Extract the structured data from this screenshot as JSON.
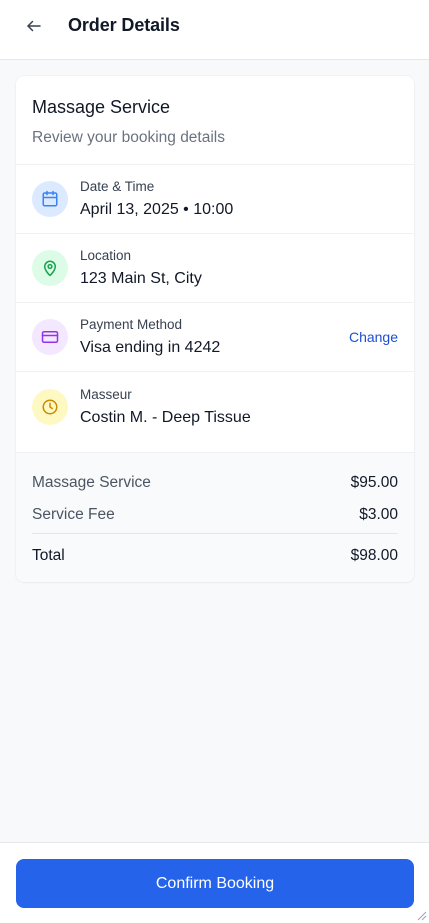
{
  "header": {
    "title": "Order Details",
    "back_icon": "arrow-left-icon"
  },
  "service": {
    "title": "Massage Service",
    "subtitle": "Review your booking details"
  },
  "details": [
    {
      "label": "Date & Time",
      "value": "April 13, 2025 • 10:00",
      "icon": "calendar-icon",
      "icon_color": "#3b82f6",
      "icon_bg": "#dbeafe"
    },
    {
      "label": "Location",
      "value": "123 Main St, City",
      "icon": "map-pin-icon",
      "icon_color": "#16a34a",
      "icon_bg": "#dcfce7"
    },
    {
      "label": "Payment Method",
      "value": "Visa ending in 4242",
      "icon": "credit-card-icon",
      "icon_color": "#9333ea",
      "icon_bg": "#f3e8ff",
      "action": "Change"
    },
    {
      "label": "Masseur",
      "value": "Costin M. - Deep Tissue",
      "icon": "clock-icon",
      "icon_color": "#ca8a04",
      "icon_bg": "#fef9c3"
    }
  ],
  "summary": {
    "lines": [
      {
        "label": "Massage Service",
        "amount": "$95.00"
      },
      {
        "label": "Service Fee",
        "amount": "$3.00"
      }
    ],
    "total_label": "Total",
    "total_amount": "$98.00"
  },
  "footer": {
    "confirm_label": "Confirm Booking"
  },
  "colors": {
    "accent": "#2563eb",
    "link": "#1d4ed8"
  }
}
